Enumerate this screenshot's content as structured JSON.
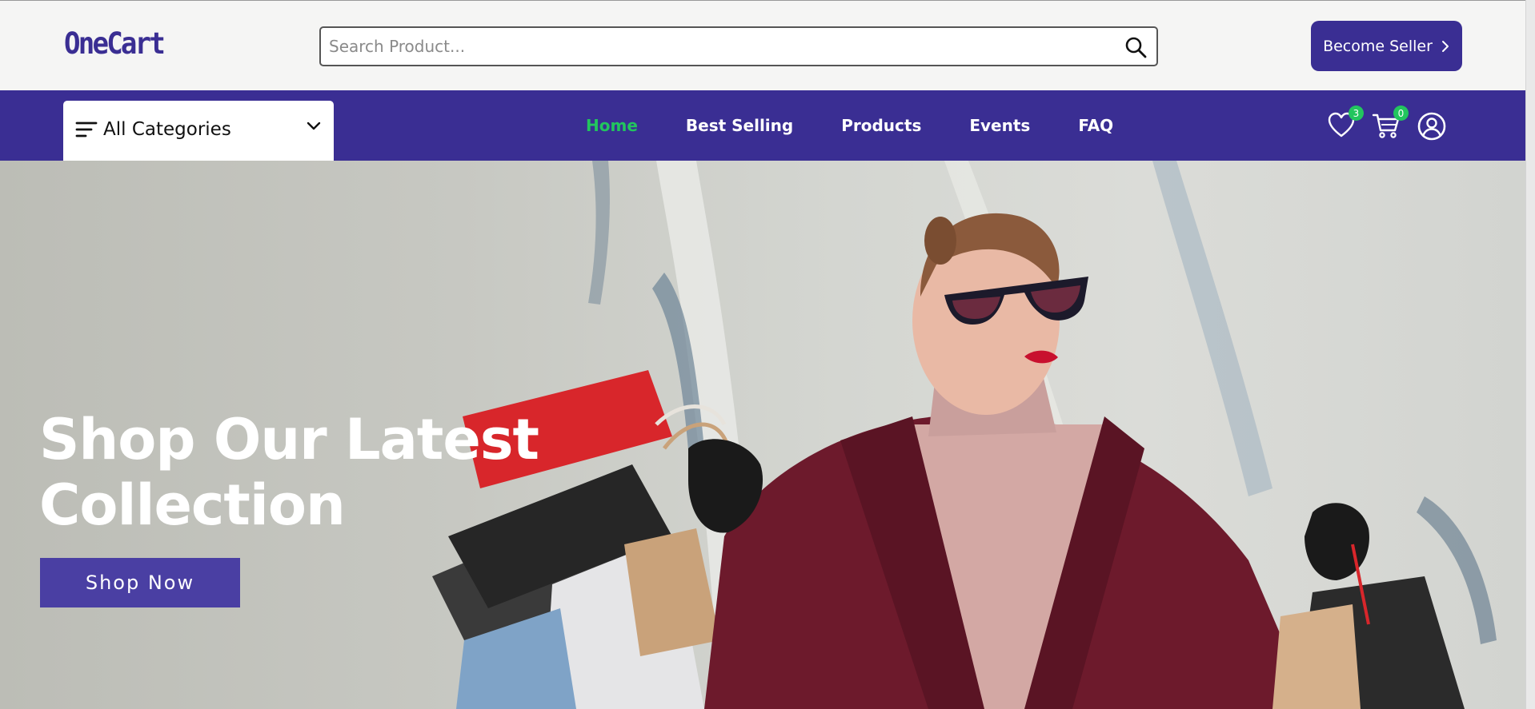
{
  "header": {
    "logo_text": "OneCart",
    "search": {
      "placeholder": "Search Product...",
      "value": ""
    },
    "become_seller_label": "Become Seller"
  },
  "nav": {
    "categories_label": "All Categories",
    "links": [
      {
        "label": "Home",
        "active": true
      },
      {
        "label": "Best Selling",
        "active": false
      },
      {
        "label": "Products",
        "active": false
      },
      {
        "label": "Events",
        "active": false
      },
      {
        "label": "FAQ",
        "active": false
      }
    ],
    "wishlist_count": "3",
    "cart_count": "0"
  },
  "hero": {
    "title_line1": "Shop Our Latest",
    "title_line2": "Collection",
    "button_label": "Shop Now"
  },
  "colors": {
    "brand": "#3a2e93",
    "active_link": "#22c55e",
    "badge": "#22c55e",
    "shop_button": "#4a3fa3"
  },
  "icons": [
    "search-icon",
    "chevron-right-icon",
    "menu-lines-icon",
    "chevron-down-icon",
    "heart-icon",
    "cart-icon",
    "user-icon"
  ]
}
